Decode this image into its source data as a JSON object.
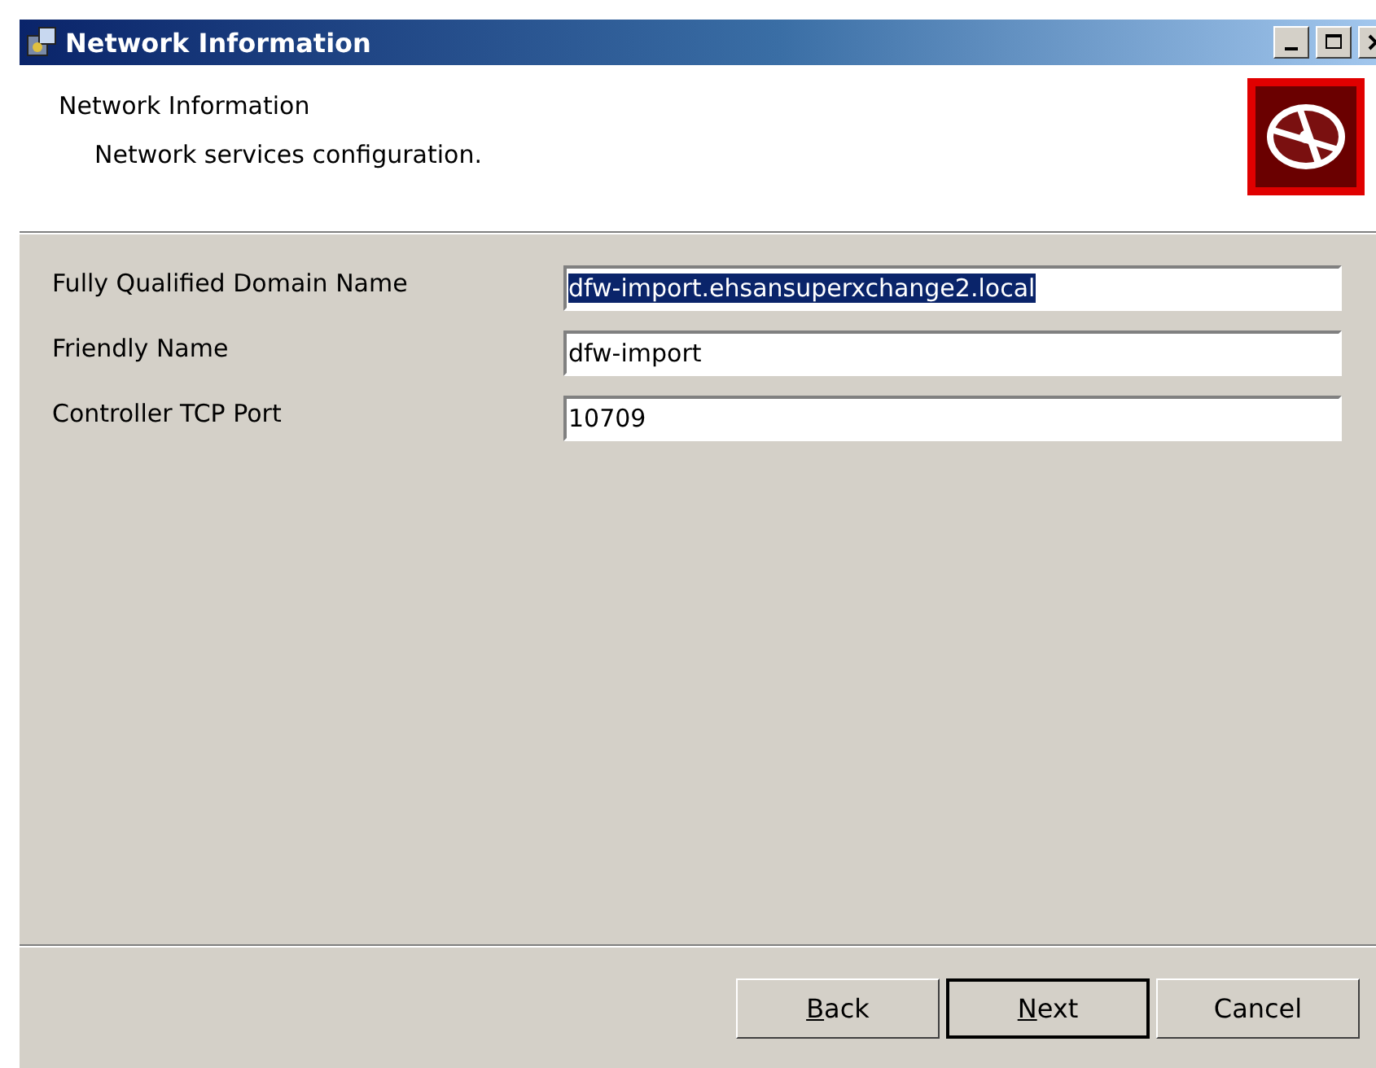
{
  "window": {
    "title": "Network Information"
  },
  "header": {
    "title": "Network Information",
    "subtitle": "Network services configuration."
  },
  "fields": [
    {
      "label": "Fully Qualified Domain Name",
      "value": "dfw-import.ehsansuperxchange2.local",
      "selected": true
    },
    {
      "label": "Friendly Name",
      "value": "dfw-import",
      "selected": false
    },
    {
      "label": "Controller TCP Port",
      "value": "10709",
      "selected": false
    }
  ],
  "buttons": [
    {
      "key": "B",
      "rest": "ack",
      "default": false
    },
    {
      "key": "N",
      "rest": "ext",
      "default": true
    },
    {
      "rest": "Cancel",
      "default": false
    }
  ]
}
